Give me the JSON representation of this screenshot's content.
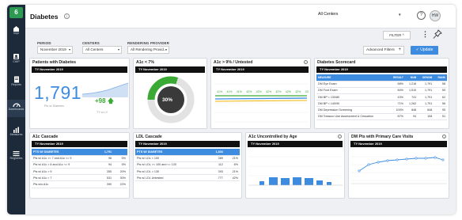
{
  "sidebar": {
    "logo": "6",
    "items": [
      {
        "label": "Impr",
        "icon": "home-icon"
      },
      {
        "label": "CHIP",
        "icon": "person-icon"
      },
      {
        "label": "Reports",
        "icon": "document-icon"
      },
      {
        "label": "Dashboards",
        "icon": "dashboard-icon"
      },
      {
        "label": "Measures",
        "icon": "bar-chart-icon"
      },
      {
        "label": "Registries",
        "icon": "list-icon"
      }
    ]
  },
  "header": {
    "title": "Diabetes",
    "info": "i",
    "center_select": "All Centers",
    "help": "?",
    "avatar": "HW"
  },
  "toolbar": {
    "filter_label": "FILTER",
    "filter_caret": "^",
    "advanced_filters_label": "Advanced Filters",
    "update_label": "Update"
  },
  "filters": {
    "period": {
      "label": "PERIOD",
      "value": "November 2019"
    },
    "centers": {
      "label": "CENTERS",
      "value": "All Centers"
    },
    "provider": {
      "label": "RENDERING PROVIDER",
      "value": "All Rendering Provid..."
    }
  },
  "band_label": "TY November 2019",
  "cards": {
    "patients": {
      "title": "Patients with Diabetes",
      "value": "1,791",
      "value_caption": "Pts w/ Diabetes",
      "trend": "+98",
      "trend_caption": "TY vs LY"
    },
    "a1c7": {
      "title": "A1c < 7%",
      "value": "30%"
    },
    "a1c9": {
      "title": "A1c > 9% / Untested",
      "labels": [
        "41%",
        "41%",
        "41%",
        "42%",
        "42%",
        "42%",
        "42%",
        "42%",
        "42%",
        "43%"
      ]
    },
    "scorecard": {
      "title": "Diabetes Scorecard",
      "columns": [
        "MEASURE",
        "RESULT",
        "NUM",
        "DENOM",
        "RANK"
      ],
      "rows": [
        [
          "DM Eye Exam",
          "68%",
          "1,216",
          "1,791",
          "58"
        ],
        [
          "DM Foot Exam",
          "84%",
          "1,510",
          "1,791",
          "55"
        ],
        [
          "DM BP < 130/80",
          "43%",
          "741",
          "1,791",
          "62"
        ],
        [
          "DM BP < 140/90",
          "71%",
          "1,262",
          "1,791",
          "56"
        ],
        [
          "DM Depression Screening",
          "100%",
          "848",
          "848",
          "95"
        ],
        [
          "DM Tobacco Use Assessment & Cessation",
          "87%",
          "94",
          "108",
          "51"
        ]
      ]
    },
    "a1c_cascade": {
      "title": "A1c Cascade",
      "rows": [
        [
          "PTS W/ DIABETES",
          "1,791",
          ""
        ],
        [
          "Pts w/ A1c >= 7 and A1c <= 9",
          "96",
          "5%"
        ],
        [
          "Pts w/ A1c > 8 and A1c <= 9",
          "94",
          "5%"
        ],
        [
          "Pts w/ A1c > 9",
          "355",
          "20%"
        ],
        [
          "Pts w/ A1c < 7",
          "531",
          "30%"
        ],
        [
          "Pts w/o A1c",
          "390",
          "22%"
        ]
      ]
    },
    "ldl_cascade": {
      "title": "LDL Cascade",
      "rows": [
        [
          "PTS W/ DIABETES",
          "1,834",
          ""
        ],
        [
          "Pts w/ LDL < 100",
          "389",
          "21%"
        ],
        [
          "Pts w/ LDL >= 100 and <= 130",
          "112",
          "6%"
        ],
        [
          "Pts w/ LDL > 130",
          "393",
          "21%"
        ],
        [
          "Pts w/ LDL Untested",
          "777",
          "42%"
        ]
      ]
    },
    "uncontrolled": {
      "title": "A1c Uncontrolled by Age"
    },
    "pcv": {
      "title": "DM Pts with Primary Care Visits"
    }
  }
}
